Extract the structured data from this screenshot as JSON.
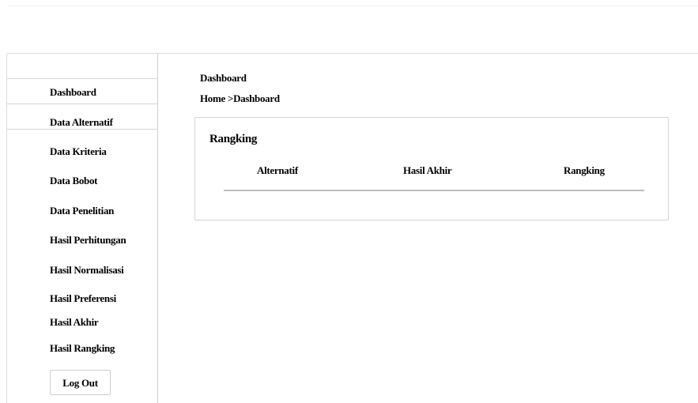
{
  "sidebar": {
    "items": [
      {
        "label": "Dashboard"
      },
      {
        "label": "Data Alternatif"
      },
      {
        "label": "Data Kriteria"
      },
      {
        "label": "Data Bobot"
      },
      {
        "label": "Data Penelitian"
      },
      {
        "label": "Hasil Perhitungan"
      },
      {
        "label": "Hasil Normalisasi"
      },
      {
        "label": "Hasil Preferensi"
      },
      {
        "label": "Hasil Akhir"
      },
      {
        "label": "Hasil Rangking"
      }
    ],
    "logout_label": "Log Out"
  },
  "main": {
    "page_title": "Dashboard",
    "breadcrumb": {
      "home": "Home",
      "separator": ">",
      "current": "Dashboard"
    },
    "card": {
      "title": "Rangking",
      "columns": [
        "Alternatif",
        "Hasil Akhir",
        "Rangking"
      ]
    }
  }
}
